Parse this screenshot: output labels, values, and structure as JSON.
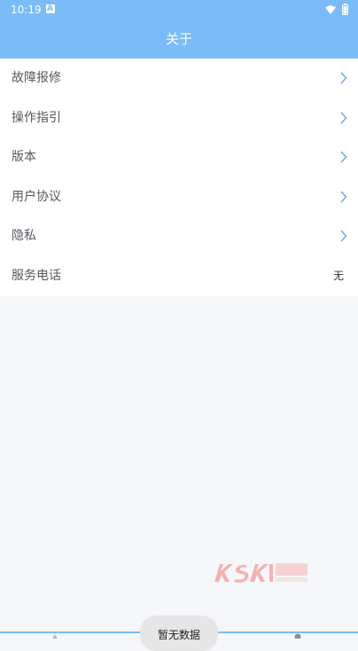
{
  "status_bar": {
    "time": "10:19",
    "notification_icon": "a-icon",
    "wifi_icon": "wifi-icon",
    "battery_icon": "battery-icon"
  },
  "header": {
    "title": "关于"
  },
  "menu": {
    "items": [
      {
        "label": "故障报修",
        "icon": "chevron-right-icon"
      },
      {
        "label": "操作指引",
        "icon": "chevron-right-icon"
      },
      {
        "label": "版本",
        "icon": "chevron-right-icon"
      },
      {
        "label": "用户协议",
        "icon": "chevron-right-icon"
      },
      {
        "label": "隐私",
        "icon": "chevron-right-icon"
      }
    ],
    "phone": {
      "label": "服务电话",
      "value": "无"
    }
  },
  "toast": {
    "text": "暂无数据"
  },
  "colors": {
    "header": "#79bcf7",
    "background": "#f6f7fa",
    "chevron": "#7aa9d8",
    "label": "#555a60"
  }
}
